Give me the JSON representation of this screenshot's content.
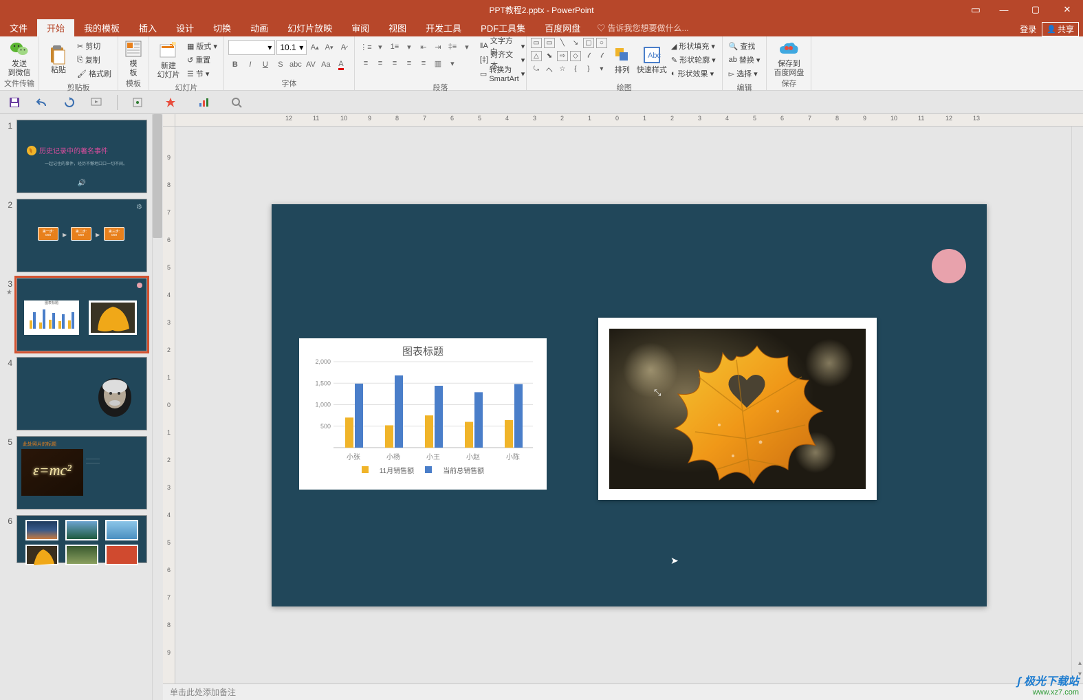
{
  "window": {
    "title": "PPT教程2.pptx - PowerPoint"
  },
  "window_controls": {
    "login": "登录",
    "share": "共享"
  },
  "tabs": {
    "file": "文件",
    "home": "开始",
    "my_template": "我的模板",
    "insert": "插入",
    "design": "设计",
    "transition": "切换",
    "animation": "动画",
    "slideshow": "幻灯片放映",
    "review": "审阅",
    "view": "视图",
    "devtools": "开发工具",
    "pdf": "PDF工具集",
    "baidu": "百度网盘",
    "tell_me": "告诉我您想要做什么..."
  },
  "ribbon": {
    "group_file": {
      "wechat": "发送\n到微信",
      "label": "文件传输"
    },
    "group_clipboard": {
      "paste": "粘贴",
      "cut": "剪切",
      "copy": "复制",
      "format_painter": "格式刷",
      "label": "剪贴板"
    },
    "group_template": {
      "template": "模\n板",
      "label": "模板"
    },
    "group_slides": {
      "new_slide": "新建\n幻灯片",
      "layout": "版式",
      "reset": "重置",
      "section": "节",
      "label": "幻灯片"
    },
    "group_font": {
      "font_name": "",
      "font_size": "10.1",
      "label": "字体"
    },
    "group_paragraph": {
      "text_direction": "文字方向",
      "align_text": "对齐文本",
      "smartart": "转换为 SmartArt",
      "label": "段落"
    },
    "group_drawing": {
      "arrange": "排列",
      "quick_style": "快速样式",
      "shape_fill": "形状填充",
      "shape_outline": "形状轮廓",
      "shape_effects": "形状效果",
      "label": "绘图"
    },
    "group_editing": {
      "find": "查找",
      "replace": "替换",
      "select": "选择",
      "label": "编辑"
    },
    "group_save": {
      "save_baidu": "保存到\n百度网盘",
      "label": "保存"
    }
  },
  "slide": {
    "chart_title": "图表标题",
    "legend1": "11月销售额",
    "legend2": "当前总销售额"
  },
  "chart_data": {
    "type": "bar",
    "title": "图表标题",
    "categories": [
      "小张",
      "小杨",
      "小王",
      "小赵",
      "小陈"
    ],
    "series": [
      {
        "name": "11月销售额",
        "color": "#f0b429",
        "values": [
          700,
          520,
          750,
          600,
          640
        ]
      },
      {
        "name": "当前总销售额",
        "color": "#4a7ec9",
        "values": [
          1490,
          1680,
          1440,
          1290,
          1480
        ]
      }
    ],
    "ylabel": "",
    "xlabel": "",
    "ylim": [
      0,
      2000
    ],
    "yticks": [
      500,
      1000,
      1500,
      2000
    ]
  },
  "thumbnails": {
    "s1_title": "历史记录中的著名事件",
    "s1_sub": "一起记住的事件，经历不懈地口口一切不间。",
    "s2_step1": "第一步:",
    "s2_step2": "第二步:",
    "s2_step3": "第三步:",
    "s3_chart_title": "图表标题",
    "s5_title": "此处照片的标题",
    "s5_formula": "ε=mc²"
  },
  "notes": {
    "placeholder": "单击此处添加备注"
  },
  "watermark": {
    "line1": "极光下载站",
    "line2": "www.xz7.com"
  },
  "ruler_h": [
    -12,
    -11,
    -10,
    -9,
    -8,
    -7,
    -6,
    -5,
    -4,
    -3,
    -2,
    -1,
    0,
    1,
    2,
    3,
    4,
    5,
    6,
    7,
    8,
    9,
    10,
    11,
    12,
    13
  ],
  "ruler_v": [
    -9,
    -8,
    -7,
    -6,
    -5,
    -4,
    -3,
    -2,
    -1,
    0,
    1,
    2,
    3,
    4,
    5,
    6,
    7,
    8,
    9
  ]
}
